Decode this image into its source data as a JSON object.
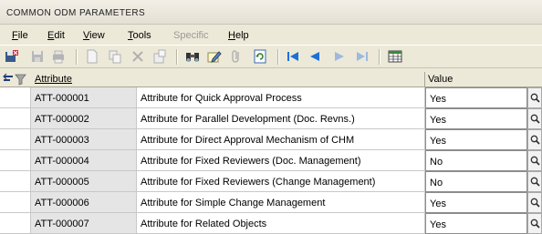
{
  "window": {
    "title": "COMMON ODM PARAMETERS"
  },
  "menu": {
    "items": [
      {
        "label": "File",
        "key": "F",
        "rest": "ile",
        "enabled": true
      },
      {
        "label": "Edit",
        "key": "E",
        "rest": "dit",
        "enabled": true
      },
      {
        "label": "View",
        "key": "V",
        "rest": "iew",
        "enabled": true
      },
      {
        "label": "Tools",
        "key": "T",
        "rest": "ools",
        "enabled": true
      },
      {
        "label": "Specific",
        "key": "",
        "rest": "Specific",
        "enabled": false
      },
      {
        "label": "Help",
        "key": "H",
        "rest": "elp",
        "enabled": true
      }
    ]
  },
  "toolbar": {
    "icons": [
      "floppy-exit-icon",
      "save-icon",
      "print-icon",
      "new-doc-icon",
      "copy-icon",
      "delete-icon",
      "paste-icon",
      "find-icon",
      "edit-note-icon",
      "attach-icon",
      "refresh-icon",
      "first-record-icon",
      "previous-record-icon",
      "next-record-icon",
      "last-record-icon",
      "table-view-icon"
    ]
  },
  "grid": {
    "columns": {
      "attribute": "Attribute",
      "value": "Value"
    },
    "rows": [
      {
        "code": "ATT-000001",
        "description": "Attribute for Quick Approval Process",
        "value": "Yes"
      },
      {
        "code": "ATT-000002",
        "description": "Attribute for Parallel Development (Doc. Revns.)",
        "value": "Yes"
      },
      {
        "code": "ATT-000003",
        "description": "Attribute for Direct Approval Mechanism of CHM",
        "value": "Yes"
      },
      {
        "code": "ATT-000004",
        "description": "Attribute for Fixed Reviewers (Doc. Management)",
        "value": "No"
      },
      {
        "code": "ATT-000005",
        "description": "Attribute for Fixed Reviewers (Change Management)",
        "value": "No"
      },
      {
        "code": "ATT-000006",
        "description": "Attribute for Simple Change Management",
        "value": "Yes"
      },
      {
        "code": "ATT-000007",
        "description": "Attribute for Related Objects",
        "value": "Yes"
      }
    ]
  },
  "colors": {
    "face": "#ece9d8",
    "nav_blue": "#1f6fd6",
    "code_cell": "#e5e5e5"
  }
}
